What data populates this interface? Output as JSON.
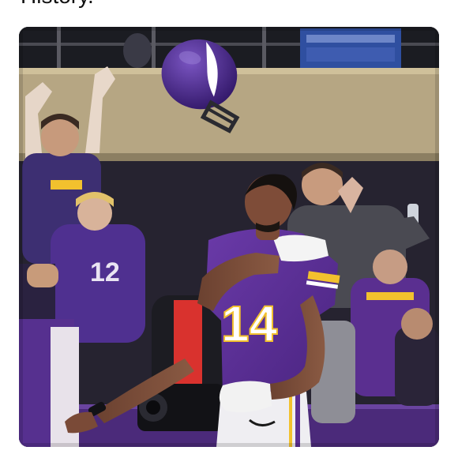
{
  "post": {
    "caption": "History."
  },
  "photo": {
    "subject": "football-player",
    "jersey_number": "14",
    "sleeve_number": "12",
    "jersey_brand_mark": "nike-swoosh",
    "colors": {
      "jersey_purple": "#5a2d91",
      "accent_gold": "#f2c12e",
      "helmet_purple": "#4b2a8a",
      "stadium_beige": "#b9a987",
      "background_dark": "#2b2430",
      "glove_white": "#f2f2f2"
    }
  }
}
